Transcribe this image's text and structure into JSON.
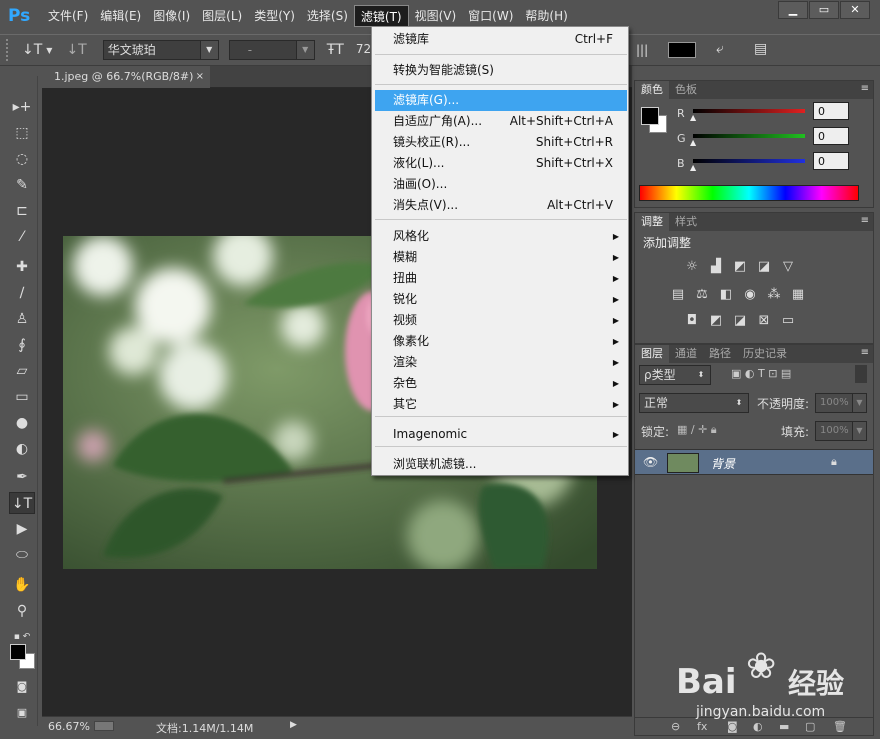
{
  "app_logo": "Ps",
  "menubar": [
    "文件(F)",
    "编辑(E)",
    "图像(I)",
    "图层(L)",
    "类型(Y)",
    "选择(S)",
    "滤镜(T)",
    "视图(V)",
    "窗口(W)",
    "帮助(H)"
  ],
  "window_controls": {
    "minimize": "▁",
    "maximize": "▭",
    "close": "✕"
  },
  "options": {
    "tool_glyph": "↓T",
    "font_family": "华文琥珀",
    "font_style": "-",
    "font_size": "72"
  },
  "document_tab": {
    "title": "1.jpeg @ 66.7%(RGB/8#)",
    "close": "×"
  },
  "status": {
    "zoom": "66.67%",
    "doc": "文档:1.14M/1.14M"
  },
  "filter_menu": {
    "items": [
      {
        "label": "滤镜库",
        "shortcut": "Ctrl+F"
      },
      {
        "label": "转换为智能滤镜(S)"
      },
      {
        "label": "滤镜库(G)...",
        "highlighted": true
      },
      {
        "label": "自适应广角(A)...",
        "shortcut": "Alt+Shift+Ctrl+A"
      },
      {
        "label": "镜头校正(R)...",
        "shortcut": "Shift+Ctrl+R"
      },
      {
        "label": "液化(L)...",
        "shortcut": "Shift+Ctrl+X"
      },
      {
        "label": "油画(O)..."
      },
      {
        "label": "消失点(V)...",
        "shortcut": "Alt+Ctrl+V"
      },
      {
        "label": "风格化",
        "submenu": true
      },
      {
        "label": "模糊",
        "submenu": true
      },
      {
        "label": "扭曲",
        "submenu": true
      },
      {
        "label": "锐化",
        "submenu": true
      },
      {
        "label": "视频",
        "submenu": true
      },
      {
        "label": "像素化",
        "submenu": true
      },
      {
        "label": "渲染",
        "submenu": true
      },
      {
        "label": "杂色",
        "submenu": true
      },
      {
        "label": "其它",
        "submenu": true
      },
      {
        "label": "Imagenomic",
        "submenu": true
      },
      {
        "label": "浏览联机滤镜..."
      }
    ]
  },
  "color_panel": {
    "tabs": [
      "颜色",
      "色板"
    ],
    "channels": [
      {
        "name": "R",
        "value": "0",
        "color": "#e02020"
      },
      {
        "name": "G",
        "value": "0",
        "color": "#20c020"
      },
      {
        "name": "B",
        "value": "0",
        "color": "#2030e0"
      }
    ]
  },
  "adjustments_panel": {
    "tabs": [
      "调整",
      "样式"
    ],
    "title": "添加调整"
  },
  "layers_panel": {
    "tabs": [
      "图层",
      "通道",
      "路径",
      "历史记录"
    ],
    "filter_kind": "ρ类型",
    "blend_mode": "正常",
    "opacity_label": "不透明度:",
    "opacity_value": "100%",
    "lock_label": "锁定:",
    "fill_label": "填充:",
    "fill_value": "100%",
    "layer_name": "背景"
  },
  "watermark": {
    "brand": "Bai",
    "brand2": "经验",
    "url": "jingyan.baidu.com"
  }
}
